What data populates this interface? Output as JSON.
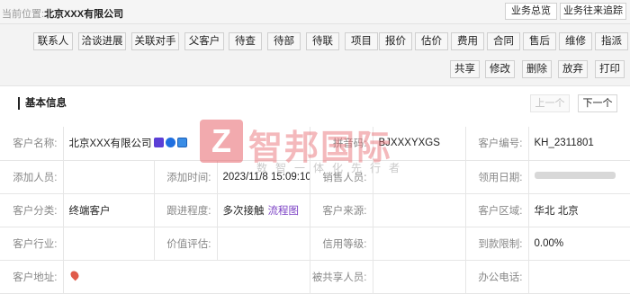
{
  "breadcrumb": {
    "label": "当前位置:",
    "current": "北京XXX有限公司"
  },
  "top_buttons": [
    "业务总览",
    "业务往来追踪"
  ],
  "toolbar_row1": [
    "联系人",
    "洽谈进展",
    "关联对手",
    "父客户",
    "待查",
    "待部",
    "待联",
    "项目",
    "报价",
    "估价",
    "费用",
    "合同",
    "售后",
    "维修",
    "指派"
  ],
  "toolbar_row2": [
    "共享",
    "修改",
    "删除",
    "放弃",
    "打印"
  ],
  "section": {
    "title": "基本信息"
  },
  "pager": {
    "prev": "上一个",
    "next": "下一个"
  },
  "fields": {
    "customer_name": {
      "label": "客户名称:",
      "value": "北京XXX有限公司"
    },
    "pinyin_code": {
      "label": "拼音码:",
      "value": "BJXXXYXGS"
    },
    "customer_no": {
      "label": "客户编号:",
      "value": "KH_2311801"
    },
    "added_by": {
      "label": "添加人员:",
      "value": ""
    },
    "added_time": {
      "label": "添加时间:",
      "value": "2023/11/8 15:09:10"
    },
    "sales_person": {
      "label": "销售人员:",
      "value": ""
    },
    "claim_date": {
      "label": "领用日期:",
      "value": ""
    },
    "category": {
      "label": "客户分类:",
      "value": "终端客户"
    },
    "progress": {
      "label": "跟进程度:",
      "value": "多次接触",
      "link": "流程图"
    },
    "source": {
      "label": "客户来源:",
      "value": ""
    },
    "region": {
      "label": "客户区域:",
      "value": "华北 北京"
    },
    "industry": {
      "label": "客户行业:",
      "value": ""
    },
    "value_eval": {
      "label": "价值评估:",
      "value": ""
    },
    "credit": {
      "label": "信用等级:",
      "value": ""
    },
    "payment_limit": {
      "label": "到款限制:",
      "value": "0.00%"
    },
    "address": {
      "label": "客户地址:",
      "value": ""
    },
    "shared_with": {
      "label": "被共享人员:",
      "value": ""
    },
    "office_phone": {
      "label": "办公电话:",
      "value": ""
    }
  },
  "watermark": {
    "text": "智邦国际",
    "sub": "数智一体化先行者"
  }
}
